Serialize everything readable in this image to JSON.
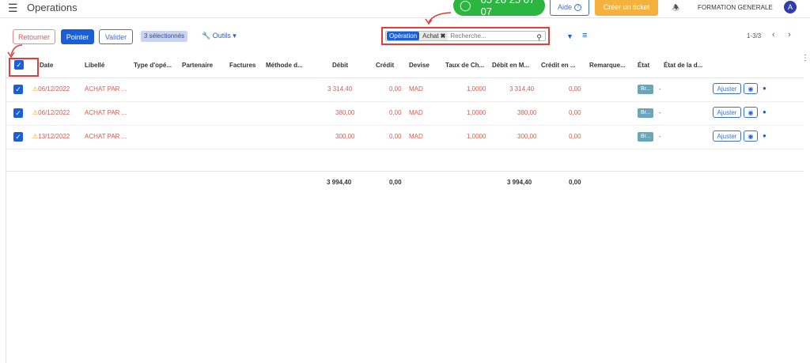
{
  "header": {
    "title": "Operations",
    "phone": "05 20 25 07 07",
    "aide_label": "Aide",
    "ticket_label": "Créer un ticket",
    "company": "FORMATION GENERALE",
    "avatar_initial": "A"
  },
  "toolbar": {
    "retourner_label": "Retourner",
    "pointer_label": "Pointer",
    "valider_label": "Valider",
    "selected_badge": "3 sélectionnés",
    "outils_label": "Outils",
    "pager_text": "1-3/3"
  },
  "search": {
    "facet_name": "Opération",
    "facet_value": "Achat",
    "placeholder": "Recherche..."
  },
  "table": {
    "columns": [
      "Date",
      "Libellé",
      "Type d'opé...",
      "Partenaire",
      "Factures",
      "Méthode d...",
      "Débit",
      "Crédit",
      "Devise",
      "Taux de Ch...",
      "Débit en M...",
      "Crédit en ...",
      "Remarque...",
      "État",
      "État de la d..."
    ],
    "rows": [
      {
        "date": "06/12/2022",
        "libelle": "ACHAT PAR ...",
        "debit": "3 314,40",
        "credit": "0,00",
        "devise": "MAD",
        "taux": "1,0000",
        "debit_m": "3 314,40",
        "credit_m": "0,00",
        "etat": "Br...",
        "etat_d": "-",
        "ajuster": "Ajuster"
      },
      {
        "date": "06/12/2022",
        "libelle": "ACHAT PAR ...",
        "debit": "380,00",
        "credit": "0,00",
        "devise": "MAD",
        "taux": "1,0000",
        "debit_m": "380,00",
        "credit_m": "0,00",
        "etat": "Br...",
        "etat_d": "-",
        "ajuster": "Ajuster"
      },
      {
        "date": "13/12/2022",
        "libelle": "ACHAT PAR ...",
        "debit": "300,00",
        "credit": "0,00",
        "devise": "MAD",
        "taux": "1,0000",
        "debit_m": "300,00",
        "credit_m": "0,00",
        "etat": "Br...",
        "etat_d": "-",
        "ajuster": "Ajuster"
      }
    ],
    "totals": {
      "debit": "3 994,40",
      "credit": "0,00",
      "debit_m": "3 994,40",
      "credit_m": "0,00"
    }
  },
  "icons": {
    "hamburger": "menu-icon",
    "headset": "headset-icon",
    "bell": "bell-icon",
    "wrench": "wrench-icon",
    "search": "search-icon",
    "filter": "filter-icon",
    "group": "list-icon",
    "warning": "warning-icon",
    "eye": "eye-icon",
    "chat": "chat-icon"
  },
  "colors": {
    "primary": "#1a5fd8",
    "phone_green": "#2bb640",
    "ticket_orange": "#f4b13d",
    "debit_red": "#e2574c",
    "highlight_red": "#e23c3c"
  }
}
